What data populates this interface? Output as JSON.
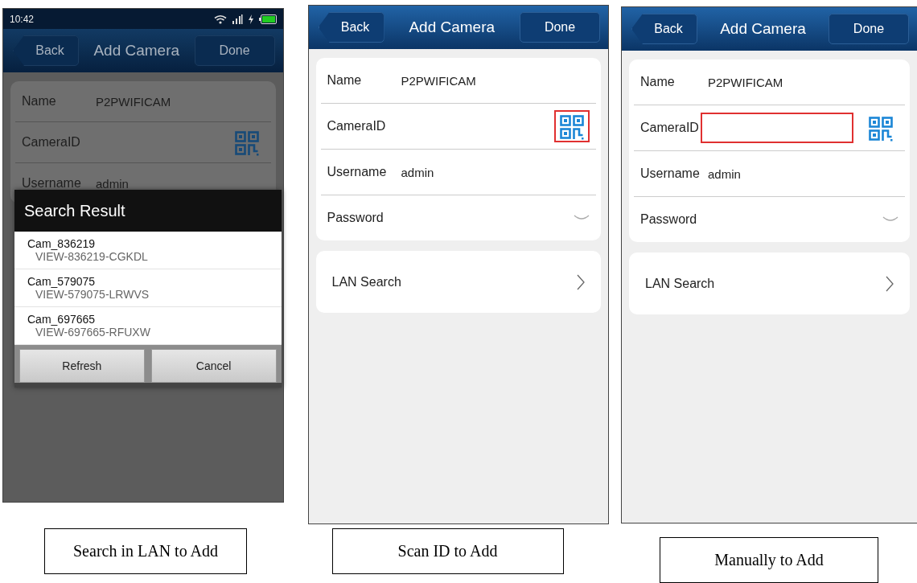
{
  "panels": [
    {
      "dimmed": true,
      "status_bar": {
        "time": "10:42"
      },
      "nav": {
        "back": "Back",
        "title": "Add Camera",
        "done": "Done"
      },
      "form": [
        {
          "kind": "text",
          "label": "Name",
          "value": "P2PWIFICAM"
        },
        {
          "kind": "qr",
          "label": "CameraID",
          "qr_highlighted": false,
          "field_highlighted": false
        },
        {
          "kind": "text",
          "label": "Username",
          "value": "admin"
        }
      ],
      "dialog": {
        "title": "Search Result",
        "results": [
          {
            "name": "Cam_836219",
            "id": "VIEW-836219-CGKDL"
          },
          {
            "name": "Cam_579075",
            "id": "VIEW-579075-LRWVS"
          },
          {
            "name": "Cam_697665",
            "id": "VIEW-697665-RFUXW"
          }
        ],
        "buttons": [
          "Refresh",
          "Cancel"
        ]
      },
      "caption": "Search in LAN to Add"
    },
    {
      "dimmed": false,
      "nav": {
        "back": "Back",
        "title": "Add Camera",
        "done": "Done"
      },
      "form": [
        {
          "kind": "text",
          "label": "Name",
          "value": "P2PWIFICAM"
        },
        {
          "kind": "qr",
          "label": "CameraID",
          "qr_highlighted": true,
          "field_highlighted": false
        },
        {
          "kind": "text",
          "label": "Username",
          "value": "admin"
        },
        {
          "kind": "password",
          "label": "Password"
        }
      ],
      "lan_search": {
        "label": "LAN Search"
      },
      "caption": "Scan ID to Add"
    },
    {
      "dimmed": false,
      "nav": {
        "back": "Back",
        "title": "Add Camera",
        "done": "Done"
      },
      "form": [
        {
          "kind": "text",
          "label": "Name",
          "value": "P2PWIFICAM"
        },
        {
          "kind": "qr",
          "label": "CameraID",
          "qr_highlighted": false,
          "field_highlighted": true
        },
        {
          "kind": "text",
          "label": "Username",
          "value": "admin"
        },
        {
          "kind": "password",
          "label": "Password"
        }
      ],
      "lan_search": {
        "label": "LAN Search"
      },
      "caption": "Manually to Add"
    }
  ]
}
